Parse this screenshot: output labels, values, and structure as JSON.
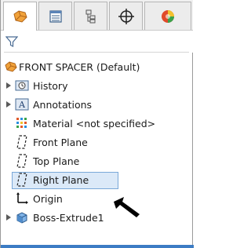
{
  "tabs": [
    {
      "name": "featuremanager-tab-icon",
      "active": true
    },
    {
      "name": "propertymanager-tab-icon",
      "active": false
    },
    {
      "name": "configurationmanager-tab-icon",
      "active": false
    },
    {
      "name": "dimxpertmanager-tab-icon",
      "active": false
    },
    {
      "name": "display-manager-tab-icon",
      "active": false
    }
  ],
  "filter": {
    "icon": "filter-icon"
  },
  "tree": {
    "root": {
      "label": "FRONT SPACER  (Default)",
      "icon": "part-icon"
    },
    "items": [
      {
        "label": "History",
        "icon": "history-folder-icon",
        "expandable": true
      },
      {
        "label": "Annotations",
        "icon": "annotations-icon",
        "expandable": true
      },
      {
        "label": "Material <not specified>",
        "icon": "material-icon",
        "expandable": false
      },
      {
        "label": "Front Plane",
        "icon": "plane-icon",
        "expandable": false
      },
      {
        "label": "Top Plane",
        "icon": "plane-icon",
        "expandable": false
      },
      {
        "label": "Right Plane",
        "icon": "plane-icon",
        "expandable": false,
        "selected": true
      },
      {
        "label": "Origin",
        "icon": "origin-icon",
        "expandable": false
      },
      {
        "label": "Boss-Extrude1",
        "icon": "extrude-feature-icon",
        "expandable": true
      }
    ]
  },
  "colors": {
    "selection_fill": "#dbe9f8",
    "selection_border": "#7aa8d8",
    "accent": "#3c7cc4"
  }
}
